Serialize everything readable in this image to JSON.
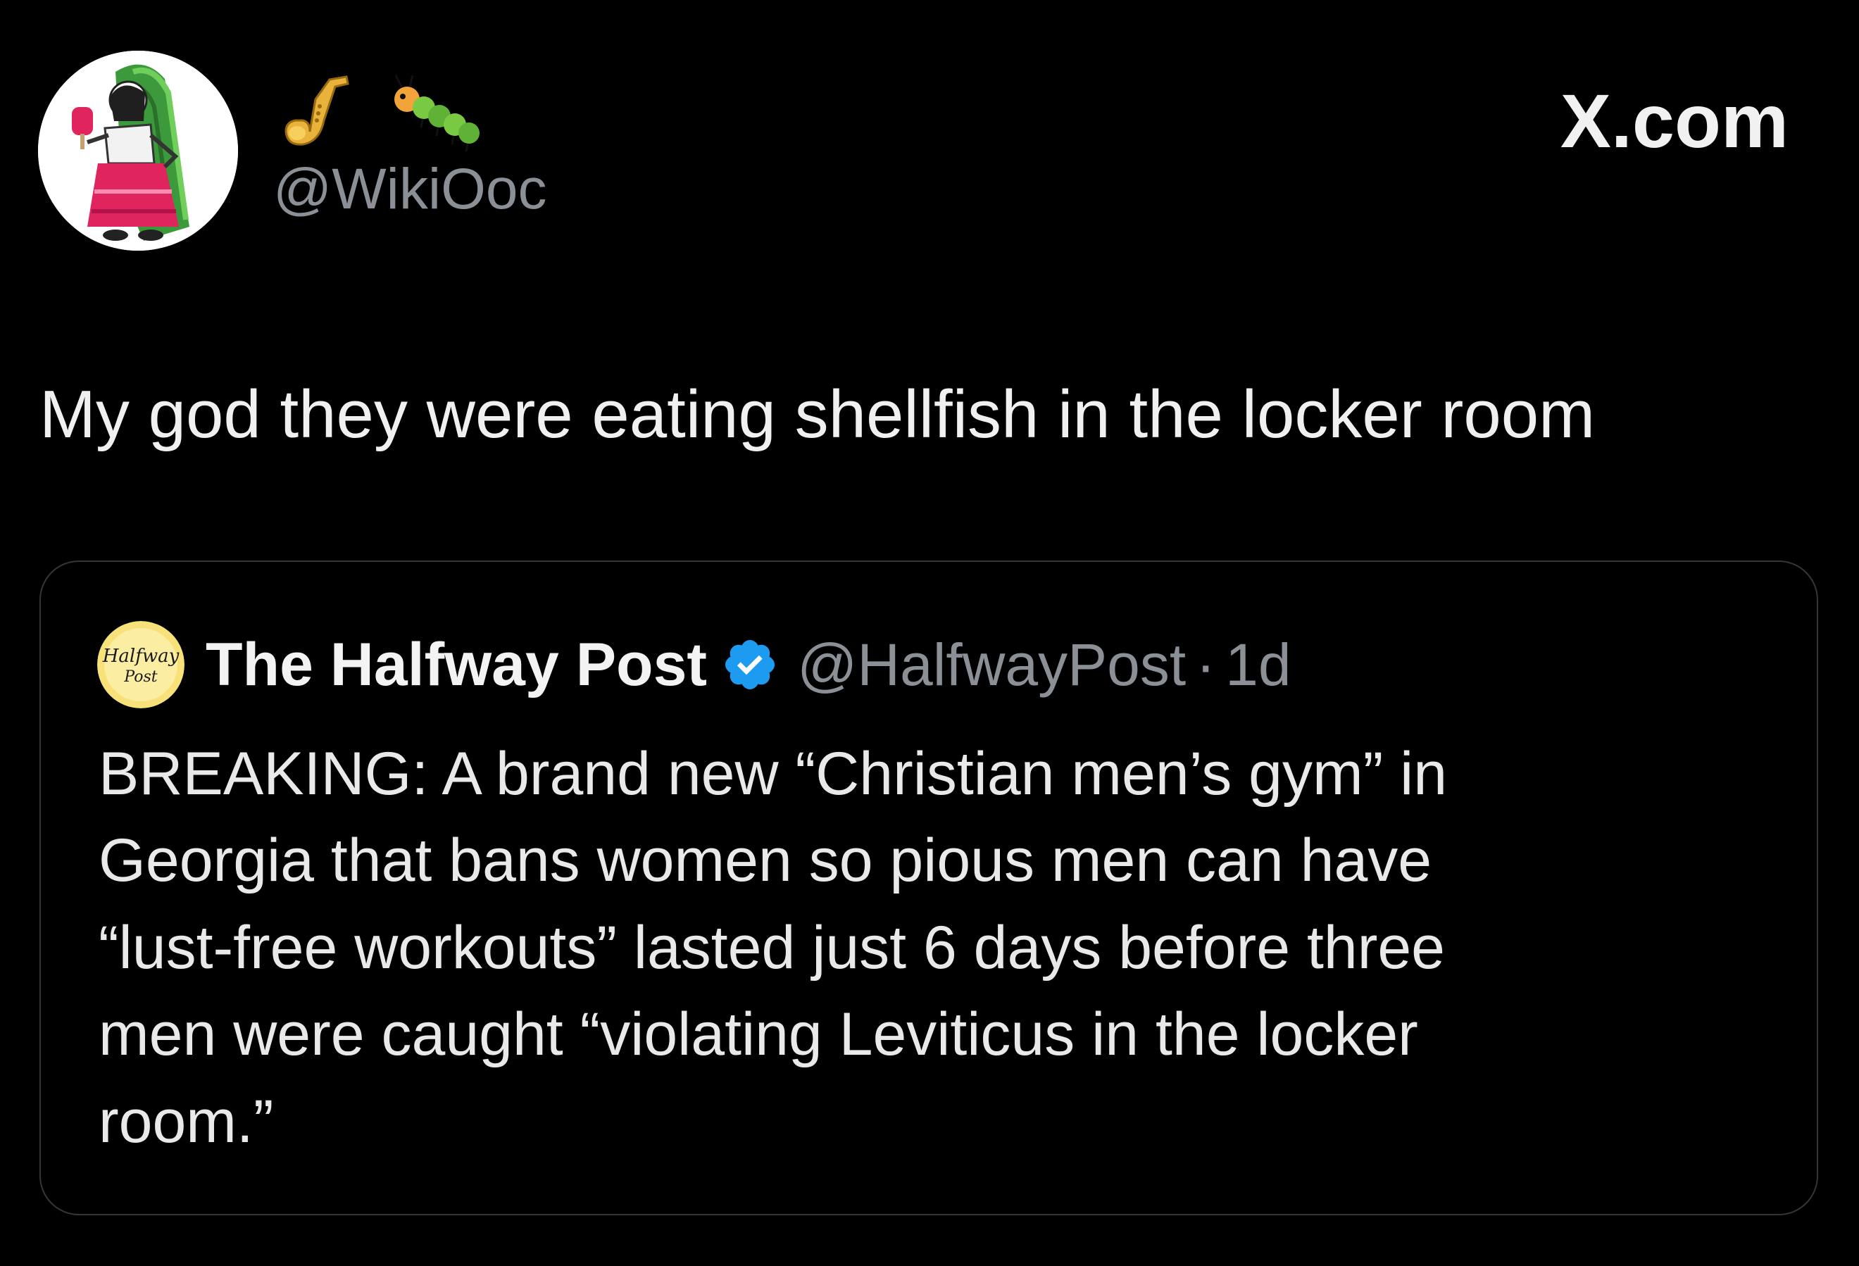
{
  "post": {
    "emojis": [
      "saxophone-icon",
      "caterpillar-icon"
    ],
    "handle": "@WikiOoc",
    "text": "My god they were eating shellfish in the locker room"
  },
  "site": {
    "label": "X.com"
  },
  "quoted_post": {
    "author_name": "The Halfway Post",
    "verified": true,
    "handle": "@HalfwayPost",
    "separator": "·",
    "time": "1d",
    "avatar_text": "Halfway Post",
    "body_lines": [
      "BREAKING: A brand new “Christian men’s gym” in",
      "Georgia that bans women so pious men can have",
      "“lust-free workouts” lasted just 6 days before three",
      "men were caught “violating Leviticus in the locker",
      "room.”"
    ]
  },
  "colors": {
    "background": "#000000",
    "primary_text": "#e7e9ea",
    "secondary_text": "#8b9096",
    "card_border": "#333639",
    "verified_badge": "#1d9bf0"
  }
}
